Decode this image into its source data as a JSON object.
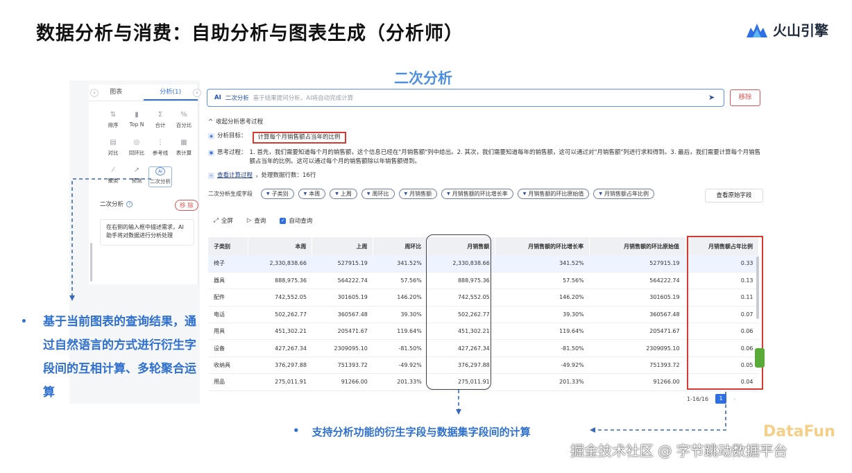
{
  "slide": {
    "title": "数据分析与消费：自助分析与图表生成（分析师）",
    "brand": "火山引擎",
    "section_label": "二次分析"
  },
  "left_panel": {
    "tabs": [
      "图表",
      "分析(1)"
    ],
    "tools": [
      {
        "label": "排序",
        "icon": "sort-icon"
      },
      {
        "label": "Top N",
        "icon": "topn-icon"
      },
      {
        "label": "合计",
        "icon": "sum-icon"
      },
      {
        "label": "百分比",
        "icon": "percent-icon"
      },
      {
        "label": "对比",
        "icon": "compare-icon"
      },
      {
        "label": "同环比",
        "icon": "yoy-icon"
      },
      {
        "label": "参考线",
        "icon": "reference-line-icon"
      },
      {
        "label": "表计算",
        "icon": "table-calc-icon"
      },
      {
        "label": "聚类",
        "icon": "cluster-icon"
      },
      {
        "label": "预测",
        "icon": "forecast-icon"
      },
      {
        "label": "二次分析",
        "icon": "ai-icon"
      }
    ],
    "section_title": "二次分析",
    "remove_label": "移 除",
    "hint": "在右侧的输入框中描述需求，AI助手将对数据进行分析处理"
  },
  "ai_bar": {
    "tag": "AI",
    "label": "二次分析",
    "placeholder": "基于结果提问分析，AI将自动完成计算",
    "remove_label": "移除"
  },
  "thinking": {
    "toggle_label": "收起分析思考过程",
    "goal_label": "分析目标：",
    "goal_value": "计算每个月销售额占当年的比例",
    "process_label": "思考过程：",
    "process_text": "1. 首先，我们需要知道每个月的销售额，这个信息已经在\"月销售额\"列中给出。2. 其次，我们需要知道每年的销售额，这可以通过对\"月销售额\"列进行求和得到。3. 最后，我们需要计算每个月销售额占当年的比例。这可以通过每个月的销售额除以年销售额得到。",
    "view_calc_label": "查看计算过程",
    "rows_processed": "，处理数据行数：16行"
  },
  "fields": {
    "label": "二次分析生成字段",
    "chips": [
      "子类别",
      "本周",
      "上周",
      "周环比",
      "月销售额",
      "月销售额的环比增长率",
      "月销售额的环比原始值",
      "月销售额占年比例"
    ],
    "view_raw_label": "查看原始字段"
  },
  "toolbar": {
    "fullscreen_label": "全屏",
    "query_label": "查询",
    "auto_query_label": "自动查询"
  },
  "table": {
    "headers": [
      "子类别",
      "本周",
      "上周",
      "周环比",
      "月销售额",
      "月销售额的环比增长率",
      "月销售额的环比原始值",
      "月销售额占年比例"
    ],
    "rows": [
      [
        "椅子",
        "2,330,838.66",
        "527915.19",
        "341.52%",
        "2,330,838.66",
        "341.52%",
        "527915.19",
        "0.33"
      ],
      [
        "器具",
        "888,975.36",
        "564222.74",
        "57.56%",
        "888,975.36",
        "57.56%",
        "564222.74",
        "0.13"
      ],
      [
        "配件",
        "742,552.05",
        "301605.19",
        "146.20%",
        "742,552.05",
        "146.20%",
        "301605.19",
        "0.11"
      ],
      [
        "电话",
        "502,262.77",
        "360567.48",
        "39.30%",
        "502,262.77",
        "39.30%",
        "360567.48",
        "0.07"
      ],
      [
        "用具",
        "451,302.21",
        "205471.67",
        "119.64%",
        "451,302.21",
        "119.64%",
        "205471.67",
        "0.06"
      ],
      [
        "设备",
        "427,267.34",
        "2309095.10",
        "-81.50%",
        "427,267.34",
        "-81.50%",
        "2309095.10",
        "0.06"
      ],
      [
        "收纳具",
        "376,297.88",
        "751393.72",
        "-49.92%",
        "376,297.88",
        "-49.92%",
        "751393.72",
        "0.05"
      ],
      [
        "用品",
        "275,011.91",
        "91266.00",
        "201.33%",
        "275,011.91",
        "201.33%",
        "91266.00",
        "0.04"
      ]
    ]
  },
  "pager": {
    "range": "1-16/16",
    "page": "1",
    "next": "›"
  },
  "annotations": {
    "bullet_dot": "•",
    "left_note": "基于当前图表的查询结果，通过自然语言的方式进行衍生字段间的互相计算、多轮聚合运算",
    "bottom_note": "支持分析功能的衍生字段与数据集字段间的计算"
  },
  "watermark": "掘金技术社区 @ 字节跳动数据平台",
  "colors": {
    "accent": "#2f6fe4",
    "annotation_blue": "#2f6fce",
    "highlight_red": "#d6392f"
  }
}
